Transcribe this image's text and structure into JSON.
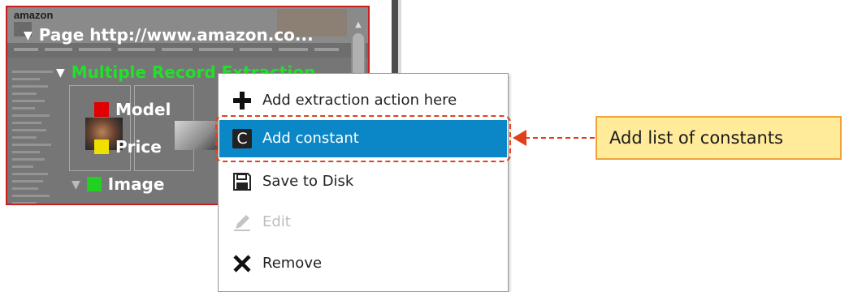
{
  "browser_preview": {
    "site_logo": "amazon",
    "tree": {
      "page_label": "Page  http://www.amazon.co...",
      "extraction_label": "Multiple Record Extraction",
      "fields": [
        {
          "name": "Model",
          "color": "#e00000"
        },
        {
          "name": "Price",
          "color": "#f0e000"
        },
        {
          "name": "Image",
          "color": "#22d022"
        }
      ]
    }
  },
  "context_menu": {
    "items": [
      {
        "label": "Add extraction action here",
        "icon": "plus-icon",
        "state": "normal"
      },
      {
        "label": "Add constant",
        "icon": "constant-c-icon",
        "state": "selected"
      },
      {
        "label": "Save to Disk",
        "icon": "floppy-disk-icon",
        "state": "normal"
      },
      {
        "label": "Edit",
        "icon": "pencil-icon",
        "state": "disabled"
      },
      {
        "label": "Remove",
        "icon": "x-icon",
        "state": "normal"
      }
    ]
  },
  "callout": {
    "text": "Add list of constants"
  },
  "colors": {
    "highlight": "#0b86c6",
    "annotation": "#e0401a",
    "callout_fill": "#ffeb9a",
    "callout_border": "#f2a23a"
  }
}
